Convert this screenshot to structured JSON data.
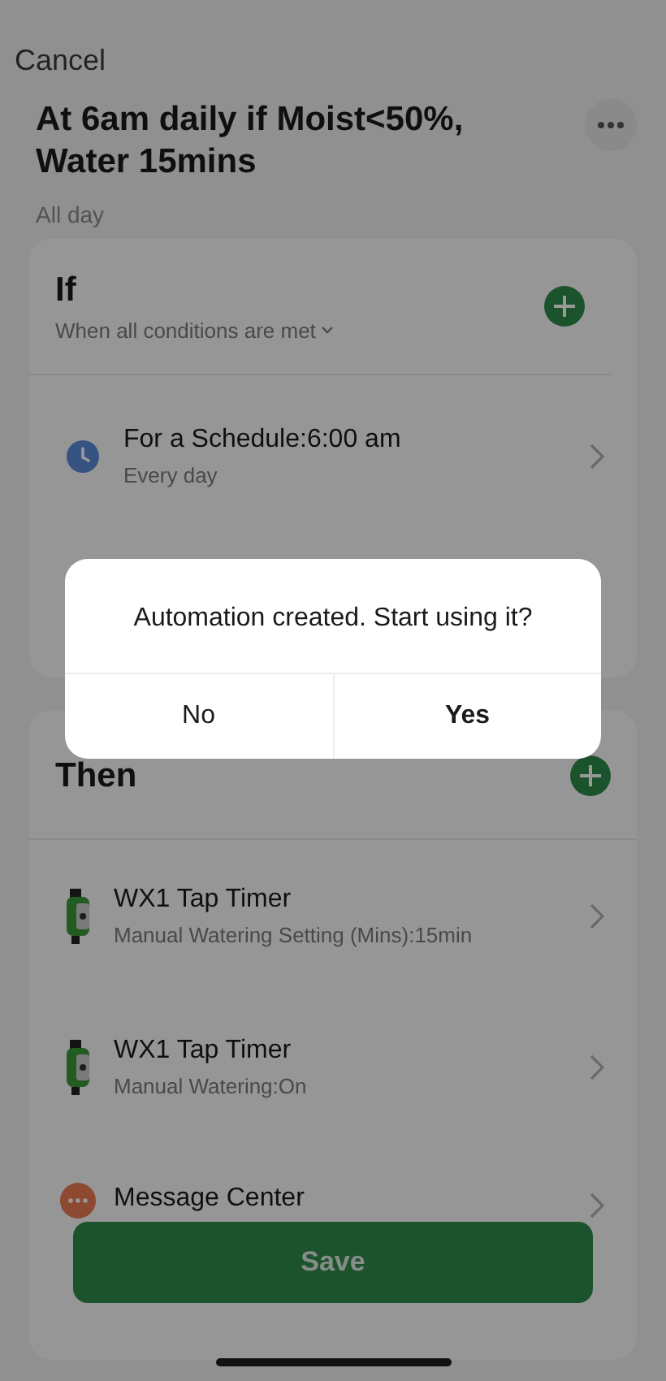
{
  "header": {
    "cancel": "Cancel",
    "title": "At 6am daily if Moist<50%, Water 15mins",
    "subtitle": "All day"
  },
  "if_section": {
    "title": "If",
    "condition_mode": "When all conditions are met",
    "items": [
      {
        "kind": "schedule",
        "title": "For a Schedule:6:00 am",
        "detail": "Every day"
      }
    ]
  },
  "then_section": {
    "title": "Then",
    "items": [
      {
        "kind": "device",
        "title": "WX1 Tap Timer",
        "detail": "Manual Watering Setting (Mins):15min"
      },
      {
        "kind": "device",
        "title": "WX1 Tap Timer",
        "detail": "Manual Watering:On"
      },
      {
        "kind": "message",
        "title": "Message Center"
      }
    ]
  },
  "save_button": "Save",
  "dialog": {
    "message": "Automation created. Start using it?",
    "buttons": [
      {
        "label": "No",
        "kind": "cancel"
      },
      {
        "label": "Yes",
        "kind": "confirm"
      }
    ]
  }
}
